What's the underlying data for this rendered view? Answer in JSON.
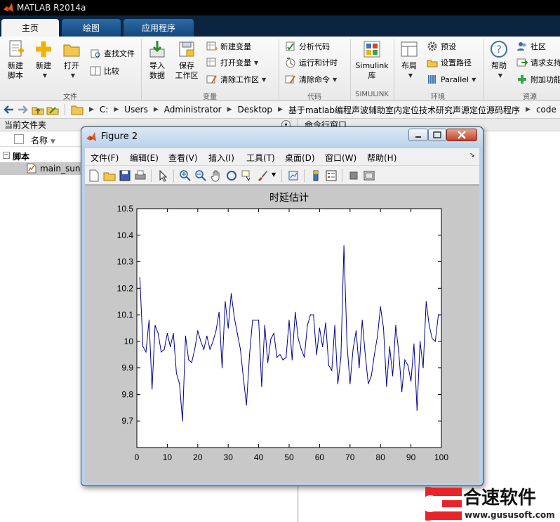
{
  "app": {
    "title": "MATLAB R2014a"
  },
  "tabs": [
    {
      "label": "主页",
      "active": true
    },
    {
      "label": "绘图",
      "active": false
    },
    {
      "label": "应用程序",
      "active": false
    }
  ],
  "ribbon": {
    "file": {
      "label": "文件",
      "new_script": "新建\n脚本",
      "new": "新建",
      "open": "打开",
      "find_files": "查找文件",
      "compare": "比较"
    },
    "variable": {
      "label": "变量",
      "import": "导入\n数据",
      "save_ws": "保存\n工作区",
      "new_var": "新建变量",
      "open_var": "打开变量",
      "clear_ws": "清除工作区"
    },
    "code": {
      "label": "代码",
      "analyze": "分析代码",
      "run_time": "运行和计时",
      "clear_cmd": "清除命令"
    },
    "simulink": {
      "label": "SIMULINK",
      "lib": "Simulink\n库"
    },
    "env": {
      "label": "环境",
      "layout": "布局",
      "prefs": "预设",
      "set_path": "设置路径",
      "parallel": "Parallel"
    },
    "resources": {
      "label": "资源",
      "help": "帮助",
      "community": "社区",
      "support": "请求支持",
      "addons": "附加功能"
    }
  },
  "address": {
    "path": [
      "C:",
      "Users",
      "Administrator",
      "Desktop",
      "基于matlab编程声波辅助室内定位技术研究声源定位源码程序",
      "code"
    ]
  },
  "folder": {
    "title": "当前文件夹",
    "col_name": "名称",
    "group": "脚本",
    "file": "main_sun..."
  },
  "command": {
    "title": "命令行窗口"
  },
  "figure": {
    "title": "Figure 2",
    "menus": [
      "文件(F)",
      "编辑(E)",
      "查看(V)",
      "插入(I)",
      "工具(T)",
      "桌面(D)",
      "窗口(W)",
      "帮助(H)"
    ]
  },
  "watermark": {
    "brand": "合速软件",
    "url": "www.gususoft.com"
  },
  "colors": {
    "line": "#00008b",
    "canvas": "#c8c8c8",
    "axes_bg": "#ffffff",
    "watermark_red": "#e8242a"
  },
  "chart_data": {
    "type": "line",
    "title": "时延估计",
    "xlabel": "",
    "ylabel": "",
    "xlim": [
      0,
      100
    ],
    "ylim": [
      9.6,
      10.5
    ],
    "xticks": [
      0,
      10,
      20,
      30,
      40,
      50,
      60,
      70,
      80,
      90,
      100
    ],
    "yticks": [
      9.7,
      9.8,
      9.9,
      10.0,
      10.1,
      10.2,
      10.3,
      10.4,
      10.5
    ],
    "ytick_labels": [
      "9.7",
      "9.8",
      "9.9",
      "10",
      "10.1",
      "10.2",
      "10.3",
      "10.4",
      "10.5"
    ],
    "grid": false,
    "series": [
      {
        "x": [
          1,
          2,
          3,
          4,
          5,
          6,
          7,
          8,
          9,
          10,
          11,
          12,
          13,
          14,
          15,
          16,
          17,
          18,
          19,
          20,
          21,
          22,
          23,
          24,
          25,
          26,
          27,
          28,
          29,
          30,
          31,
          32,
          33,
          34,
          35,
          36,
          37,
          38,
          39,
          40,
          41,
          42,
          43,
          44,
          45,
          46,
          47,
          48,
          49,
          50,
          51,
          52,
          53,
          54,
          55,
          56,
          57,
          58,
          59,
          60,
          61,
          62,
          63,
          64,
          65,
          66,
          67,
          68,
          69,
          70,
          71,
          72,
          73,
          74,
          75,
          76,
          77,
          78,
          79,
          80,
          81,
          82,
          83,
          84,
          85,
          86,
          87,
          88,
          89,
          90,
          91,
          92,
          93,
          94,
          95,
          96,
          97,
          98,
          99,
          100
        ],
        "values": [
          10.24,
          9.98,
          9.96,
          10.08,
          9.82,
          10.06,
          10.03,
          9.96,
          9.97,
          10.03,
          9.98,
          10.03,
          9.88,
          9.84,
          9.7,
          10.02,
          9.93,
          9.92,
          9.97,
          10.04,
          10.0,
          9.97,
          10.02,
          9.97,
          10.0,
          10.04,
          10.11,
          9.9,
          10.15,
          10.05,
          10.18,
          10.09,
          10.03,
          9.97,
          9.86,
          9.76,
          9.95,
          10.08,
          10.08,
          10.08,
          9.83,
          10.06,
          9.92,
          10.01,
          10.03,
          9.94,
          9.95,
          9.93,
          9.94,
          10.08,
          9.93,
          10.11,
          10.01,
          9.97,
          9.94,
          10.06,
          10.1,
          10.1,
          9.95,
          10.05,
          9.98,
          10.07,
          9.91,
          9.89,
          10.06,
          9.84,
          9.94,
          10.36,
          9.99,
          9.84,
          9.97,
          10.04,
          9.9,
          10.08,
          9.95,
          9.84,
          9.87,
          9.95,
          10.02,
          10.13,
          10.05,
          9.83,
          9.98,
          9.87,
          10.06,
          9.96,
          9.81,
          9.93,
          9.91,
          9.85,
          9.99,
          9.74,
          10.0,
          9.9,
          10.15,
          10.06,
          10.01,
          10.0,
          10.1,
          10.1
        ]
      }
    ]
  }
}
